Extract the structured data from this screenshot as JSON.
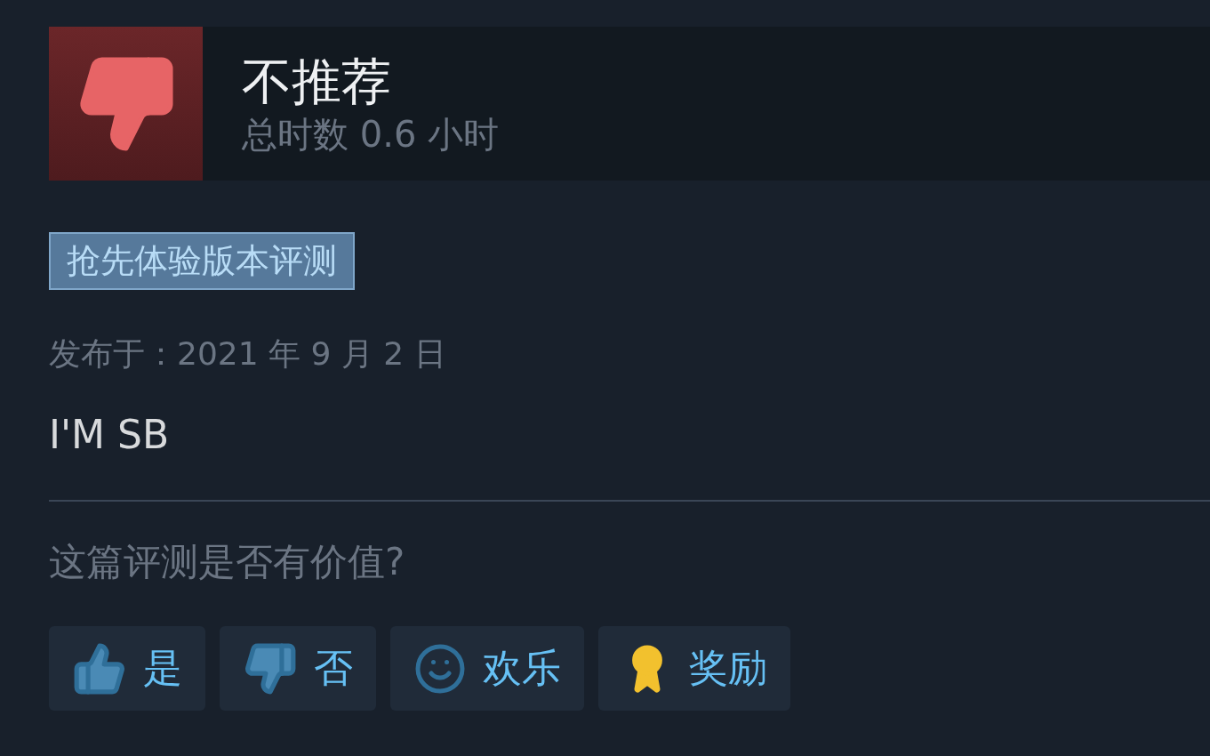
{
  "review": {
    "verdict": "不推荐",
    "recommended": false,
    "playtime": "总时数 0.6 小时"
  },
  "tag": "抢先体验版本评测",
  "posted": "发布于：2021 年 9 月 2 日",
  "body": "I'M SB",
  "question": "这篇评测是否有价值?",
  "buttons": [
    {
      "kind": "yes",
      "label": "是"
    },
    {
      "kind": "no",
      "label": "否"
    },
    {
      "kind": "funny",
      "label": "欢乐"
    },
    {
      "kind": "award",
      "label": "奖励"
    }
  ]
}
